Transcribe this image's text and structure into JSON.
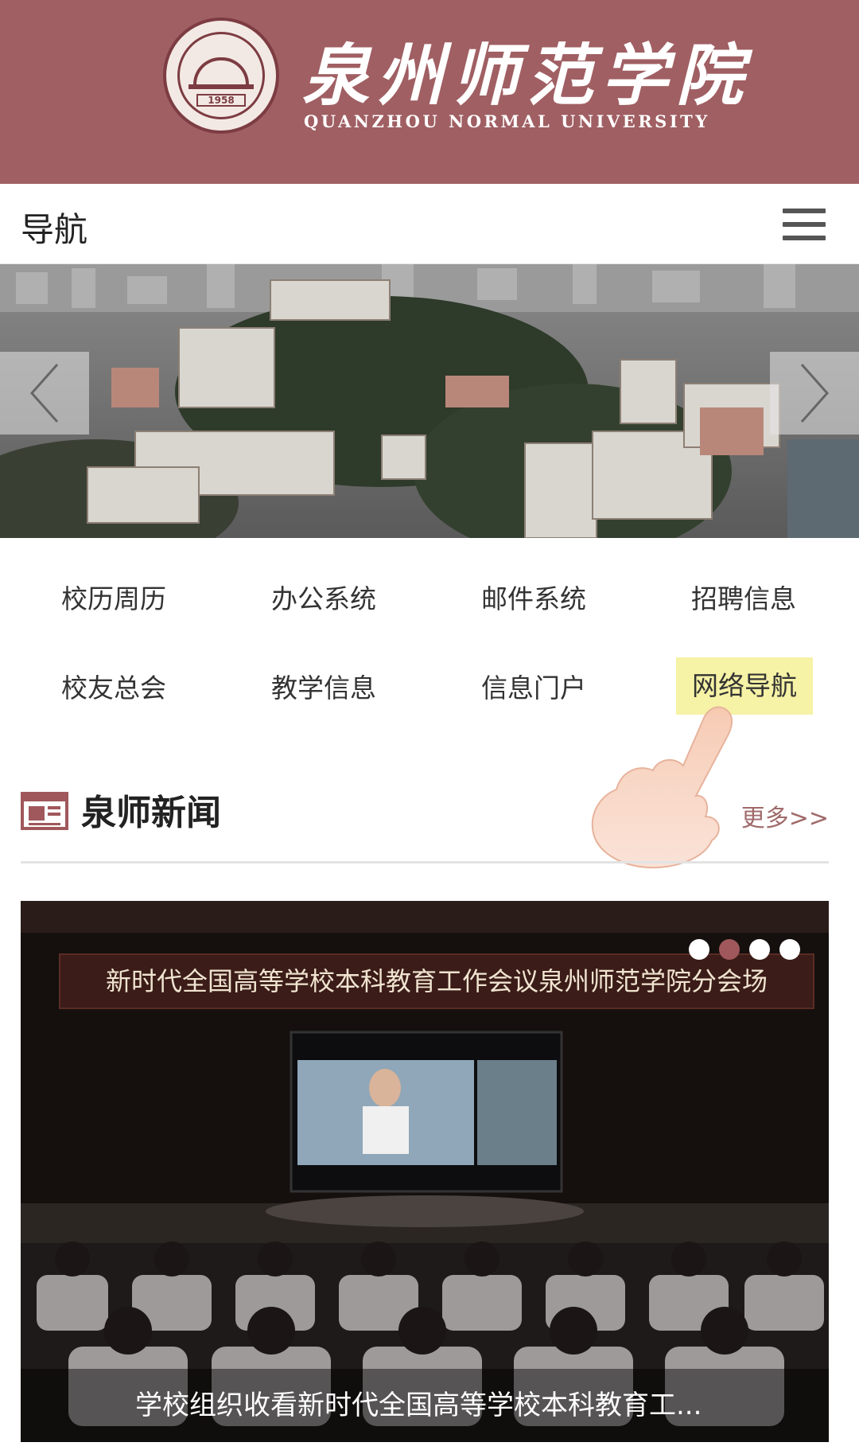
{
  "header": {
    "title_cn": "泉州师范学院",
    "title_en": "QUANZHOU NORMAL UNIVERSITY",
    "seal_year": "1958",
    "brand_color": "#a05f63"
  },
  "navbar": {
    "title": "导航",
    "menu_icon": "hamburger-menu-icon"
  },
  "banner": {
    "prev_icon": "chevron-left-icon",
    "next_icon": "chevron-right-icon"
  },
  "quick_links": [
    {
      "label": "校历周历"
    },
    {
      "label": "办公系统"
    },
    {
      "label": "邮件系统"
    },
    {
      "label": "招聘信息"
    },
    {
      "label": "校友总会"
    },
    {
      "label": "教学信息"
    },
    {
      "label": "信息门户"
    },
    {
      "label": "网络导航",
      "highlighted": true
    }
  ],
  "news": {
    "title": "泉师新闻",
    "more": "更多>>",
    "icon": "newspaper-icon",
    "stage_banner": "新时代全国高等学校本科教育工作会议泉州师范学院分会场",
    "caption": "学校组织收看新时代全国高等学校本科教育工...",
    "slides_total": 4,
    "active_slide": 2
  },
  "colors": {
    "accent": "#a05f63",
    "highlight": "#f6f2a6",
    "more_link": "#a06a6a"
  }
}
